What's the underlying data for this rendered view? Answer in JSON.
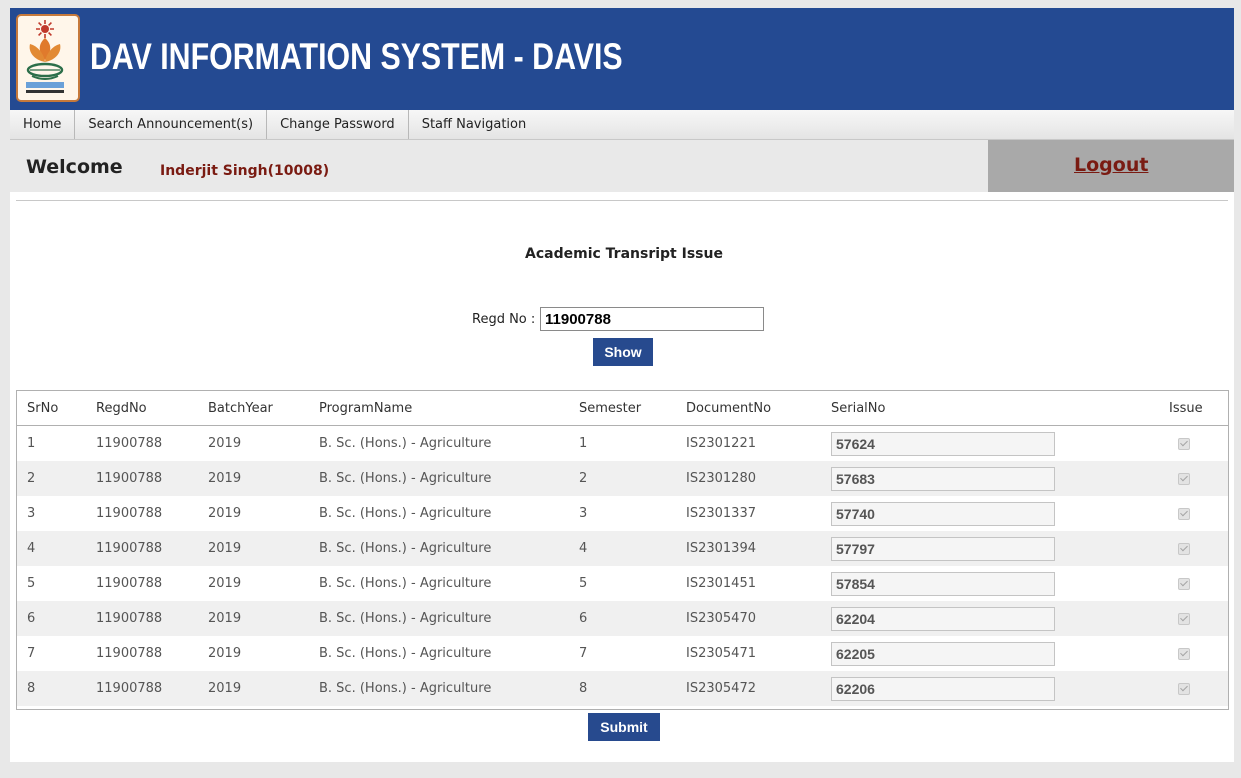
{
  "header": {
    "title": "DAV INFORMATION SYSTEM - DAVIS",
    "logo_icon": "dav-university-logo-icon"
  },
  "nav": {
    "items": [
      {
        "label": "Home"
      },
      {
        "label": "Search Announcement(s)"
      },
      {
        "label": "Change Password"
      },
      {
        "label": "Staff Navigation"
      }
    ]
  },
  "welcome": {
    "label": "Welcome",
    "user": "Inderjit Singh(10008)",
    "logout": "Logout"
  },
  "form": {
    "title": "Academic Transript Issue",
    "regd_label": "Regd No :",
    "regd_value": "11900788",
    "show_button": "Show",
    "submit_button": "Submit"
  },
  "table": {
    "columns": [
      "SrNo",
      "RegdNo",
      "BatchYear",
      "ProgramName",
      "Semester",
      "DocumentNo",
      "SerialNo",
      "Issue"
    ],
    "rows": [
      {
        "sr": "1",
        "regd": "11900788",
        "batch": "2019",
        "program": "B. Sc. (Hons.) - Agriculture",
        "sem": "1",
        "doc": "IS2301221",
        "serial": "57624",
        "issue": true
      },
      {
        "sr": "2",
        "regd": "11900788",
        "batch": "2019",
        "program": "B. Sc. (Hons.) - Agriculture",
        "sem": "2",
        "doc": "IS2301280",
        "serial": "57683",
        "issue": true
      },
      {
        "sr": "3",
        "regd": "11900788",
        "batch": "2019",
        "program": "B. Sc. (Hons.) - Agriculture",
        "sem": "3",
        "doc": "IS2301337",
        "serial": "57740",
        "issue": true
      },
      {
        "sr": "4",
        "regd": "11900788",
        "batch": "2019",
        "program": "B. Sc. (Hons.) - Agriculture",
        "sem": "4",
        "doc": "IS2301394",
        "serial": "57797",
        "issue": true
      },
      {
        "sr": "5",
        "regd": "11900788",
        "batch": "2019",
        "program": "B. Sc. (Hons.) - Agriculture",
        "sem": "5",
        "doc": "IS2301451",
        "serial": "57854",
        "issue": true
      },
      {
        "sr": "6",
        "regd": "11900788",
        "batch": "2019",
        "program": "B. Sc. (Hons.) - Agriculture",
        "sem": "6",
        "doc": "IS2305470",
        "serial": "62204",
        "issue": true
      },
      {
        "sr": "7",
        "regd": "11900788",
        "batch": "2019",
        "program": "B. Sc. (Hons.) - Agriculture",
        "sem": "7",
        "doc": "IS2305471",
        "serial": "62205",
        "issue": true
      },
      {
        "sr": "8",
        "regd": "11900788",
        "batch": "2019",
        "program": "B. Sc. (Hons.) - Agriculture",
        "sem": "8",
        "doc": "IS2305472",
        "serial": "62206",
        "issue": true
      }
    ]
  },
  "colors": {
    "header_bg": "#244a92",
    "button_bg": "#274a8e",
    "user_text": "#7a1b12",
    "logout_bg": "#a9a9a9"
  }
}
